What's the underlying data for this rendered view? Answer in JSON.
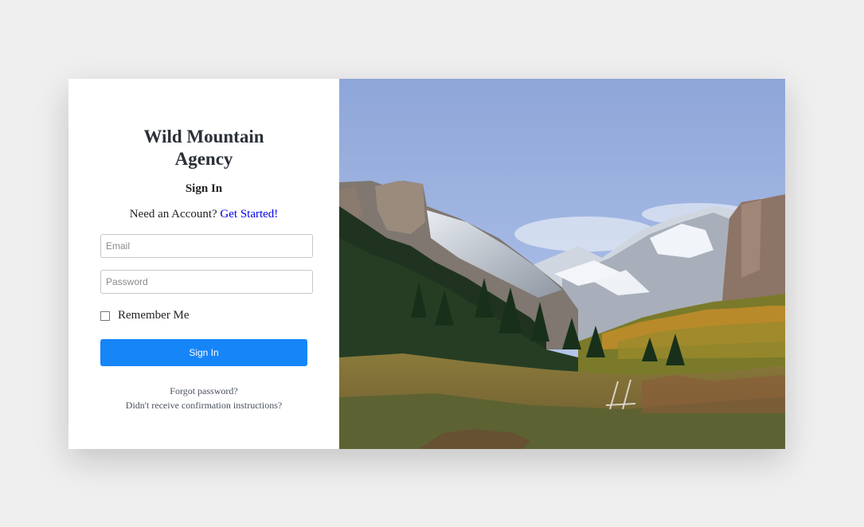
{
  "brand": {
    "title_line1": "Wild Mountain",
    "title_line2": "Agency"
  },
  "form": {
    "heading": "Sign In",
    "need_account_text": "Need an Account?",
    "get_started_link": "Get Started!",
    "email_placeholder": "Email",
    "password_placeholder": "Password",
    "remember_label": "Remember Me",
    "submit_label": "Sign In"
  },
  "footer_links": {
    "forgot_password": "Forgot password?",
    "confirmation": "Didn't receive confirmation instructions?"
  },
  "colors": {
    "primary_button": "#1685f8",
    "link": "#0000ee",
    "background": "#efefef"
  }
}
